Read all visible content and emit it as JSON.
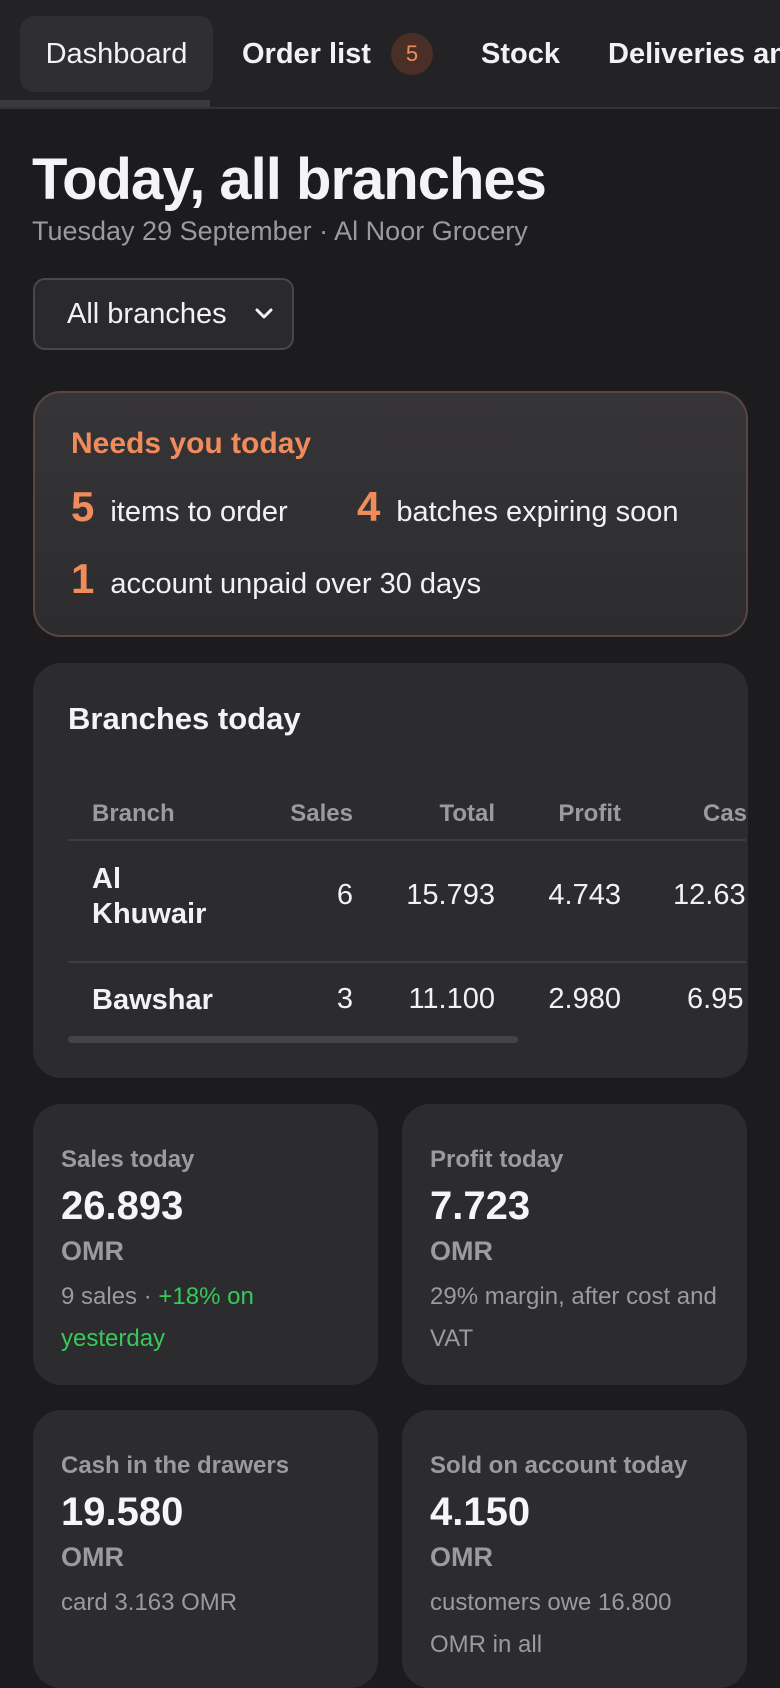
{
  "tabs": [
    {
      "label": "Dashboard",
      "active": true
    },
    {
      "label": "Order list",
      "badge": "5"
    },
    {
      "label": "Stock"
    },
    {
      "label": "Deliveries an"
    }
  ],
  "header": {
    "title": "Today, all branches",
    "subtitle": "Tuesday 29 September · Al Noor Grocery"
  },
  "branch_filter": {
    "selected": "All branches"
  },
  "needs": {
    "title": "Needs you today",
    "items": [
      {
        "count": "5",
        "text": "items to order"
      },
      {
        "count": "4",
        "text": "batches expiring soon"
      },
      {
        "count": "1",
        "text": "account unpaid over 30 days"
      }
    ]
  },
  "branches_table": {
    "title": "Branches today",
    "columns": [
      "Branch",
      "Sales",
      "Total",
      "Profit",
      "Cas"
    ],
    "rows": [
      {
        "name_line1": "Al",
        "name_line2": "Khuwair",
        "sales": "6",
        "total": "15.793",
        "profit": "4.743",
        "cash": "12.63"
      },
      {
        "name_line1": "Bawshar",
        "name_line2": "",
        "sales": "3",
        "total": "11.100",
        "profit": "2.980",
        "cash": "6.95"
      }
    ]
  },
  "stats": {
    "sales": {
      "label": "Sales today",
      "value": "26.893",
      "unit": "OMR",
      "note_prefix": "9 sales · ",
      "note_highlight": "+18% on yesterday"
    },
    "profit": {
      "label": "Profit today",
      "value": "7.723",
      "unit": "OMR",
      "note": "29% margin, after cost and VAT"
    },
    "cash": {
      "label": "Cash in the drawers",
      "value": "19.580",
      "unit": "OMR",
      "note": "card 3.163 OMR"
    },
    "account": {
      "label": "Sold on account today",
      "value": "4.150",
      "unit": "OMR",
      "note": "customers owe 16.800 OMR in all"
    }
  },
  "colors": {
    "accent": "#f08c5c",
    "positive": "#38c85a",
    "background": "#1c1c1e",
    "card": "#2c2c2e"
  }
}
